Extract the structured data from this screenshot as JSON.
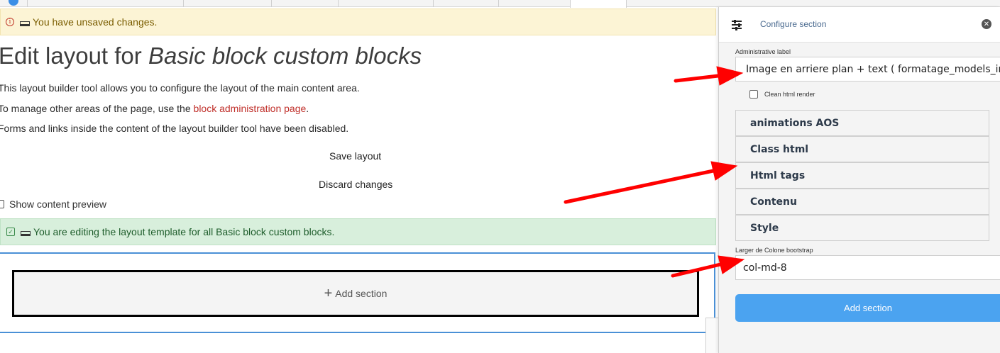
{
  "warning_message": "You have unsaved changes.",
  "page_title_prefix": "Edit layout for ",
  "page_title_entity": "Basic block custom blocks",
  "paragraphs": {
    "p1": "This layout builder tool allows you to configure the layout of the main content area.",
    "p2_before": "To manage other areas of the page, use the ",
    "p2_link": "block administration page",
    "p2_after": ".",
    "p3": "Forms and links inside the content of the layout builder tool have been disabled."
  },
  "actions": {
    "save": "Save layout",
    "discard": "Discard changes"
  },
  "show_content_preview": "Show content preview",
  "status_message": "You are editing the layout template for all Basic block custom blocks.",
  "add_section_label": "Add section",
  "panel": {
    "title": "Configure section",
    "admin_label_caption": "Administrative label",
    "admin_label_value": "Image en arriere plan + text  ( formatage_models_ima",
    "clean_html_label": "Clean html render",
    "accordions": [
      "animations AOS",
      "Class html",
      "Html tags",
      "Contenu",
      "Style"
    ],
    "width_caption": "Larger de Colone bootstrap",
    "width_value": "col-md-8",
    "submit_label": "Add section"
  },
  "colors": {
    "warning_bg": "#fcf4d5",
    "success_bg": "#d8efdc",
    "primary_button": "#4ba3f0",
    "link": "#c0302b",
    "annotation_arrow": "#ff0000"
  },
  "icons": [
    "info-icon",
    "keyboard-icon",
    "check-icon",
    "plus-icon",
    "sliders-icon",
    "close-icon"
  ]
}
